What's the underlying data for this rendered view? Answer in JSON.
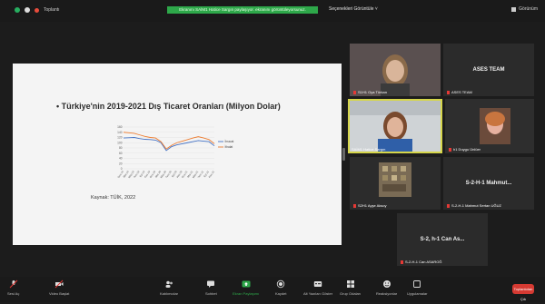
{
  "topbar": {
    "meeting_info": "Toplantı",
    "share_banner": "Ekranını SAİM1 Hatice Sargın paylaşıyor. ekranını görüntüleyorsunuz.",
    "view_options": "Seçenekleri Görüntüle",
    "view_mode": "Görünüm"
  },
  "slide": {
    "title": "• Türkiye'nin 2019-2021 Dış Ticaret Oranları (Milyon Dolar)",
    "source": "Kaynak: TÜİK, 2022"
  },
  "chart_data": {
    "type": "line",
    "x": [
      "Oca.19",
      "Mar.19",
      "May.19",
      "Tem.19",
      "Eyl.19",
      "Kas.19",
      "Oca.20",
      "Mar.20",
      "May.20",
      "Tem.20",
      "Eyl.20",
      "Kas.20",
      "Oca.21",
      "Mar.21",
      "May.21",
      "Tem.21",
      "Eyl.21",
      "Kas.21"
    ],
    "yticks": [
      "160",
      "140",
      "120",
      "100",
      "80",
      "60",
      "40",
      "20",
      "0"
    ],
    "ylim": [
      0,
      160
    ],
    "series": [
      {
        "name": "İhracat",
        "color": "#4472c4",
        "values": [
          118,
          119,
          120,
          116,
          113,
          112,
          110,
          100,
          70,
          85,
          92,
          96,
          100,
          104,
          108,
          106,
          104,
          88
        ]
      },
      {
        "name": "İthalat",
        "color": "#ed7d31",
        "values": [
          140,
          138,
          136,
          130,
          124,
          120,
          118,
          104,
          76,
          90,
          100,
          106,
          112,
          118,
          123,
          118,
          112,
          96
        ]
      }
    ]
  },
  "participants": [
    {
      "name": "S1H1 Oya Türkan",
      "kind": "video"
    },
    {
      "name": "ASES TEAM",
      "kind": "name",
      "label": "ASES TEAM"
    },
    {
      "name": "SAİM1 Hatice Sargın",
      "kind": "video"
    },
    {
      "name": "h1 Duygu Ünlüer",
      "kind": "video"
    },
    {
      "name": "S2H1 Ayşe Aksoy",
      "kind": "video"
    },
    {
      "name": "S-2-H-1 Mahmut Sertan UĞUZ",
      "kind": "name",
      "label": "S-2-H-1 Mahmut..."
    },
    {
      "name": "S-2-H-1 Can ASAROĞ",
      "kind": "name",
      "label": "S-2, h-1 Can As..."
    }
  ],
  "toolbar": {
    "mute": "Sesi Aç",
    "video": "Video Başlat",
    "participants": "Katılımcılar",
    "participants_count": "43",
    "chat": "Sohbet",
    "share": "Ekran Paylaşımı",
    "record": "Kaydet",
    "captions": "Alt Yazıları Göster",
    "breakout": "Grup Odaları",
    "reactions": "Reaksiyonlar",
    "apps": "Uygulamalar",
    "end": "Toplantıdan Çık"
  }
}
